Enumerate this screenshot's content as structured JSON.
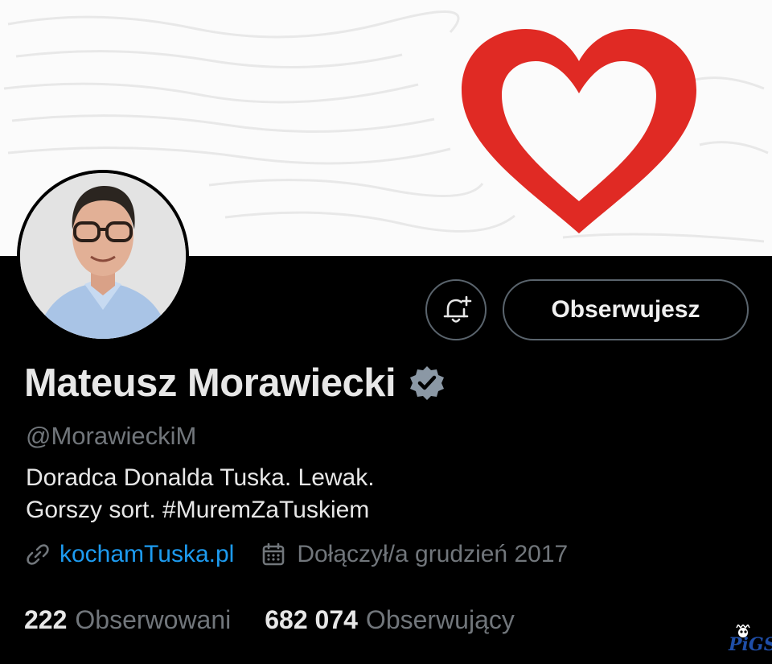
{
  "profile": {
    "name": "Mateusz Morawiecki",
    "handle": "@MorawieckiM",
    "bio_line1": "Doradca Donalda Tuska. Lewak.",
    "bio_line2": "Gorszy sort. #MuremZaTuskiem",
    "website": "kochamTuska.pl",
    "joined": "Dołączył/a grudzień 2017",
    "verified": true
  },
  "actions": {
    "follow_label": "Obserwujesz"
  },
  "stats": {
    "following_count": "222",
    "following_label": "Obserwowani",
    "followers_count": "682 074",
    "followers_label": "Obserwujący"
  },
  "icons": {
    "notify": "bell-plus-icon",
    "link": "link-icon",
    "calendar": "calendar-icon",
    "verified": "verified-badge-icon"
  },
  "colors": {
    "background": "#000000",
    "banner_heart": "#e02a24",
    "link": "#1d9bf0",
    "secondary_text": "#71767b",
    "primary_text": "#e7e7e7",
    "verified_badge": "#8b98a5"
  },
  "watermark": "PiGS"
}
